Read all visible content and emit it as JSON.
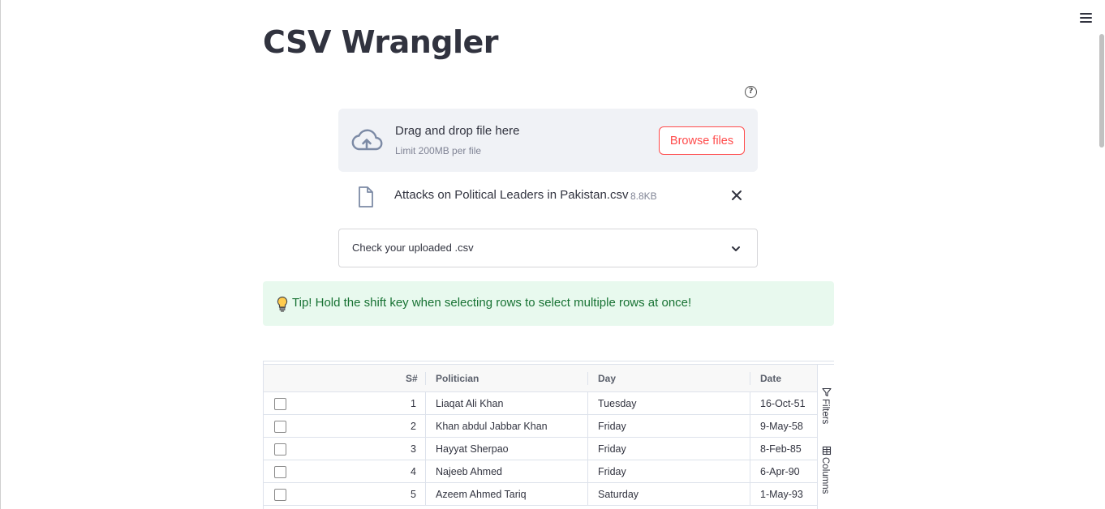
{
  "app": {
    "title": "CSV Wrangler",
    "menu_icon": "hamburger-menu-icon"
  },
  "uploader": {
    "help_icon": "question-circle-icon",
    "upload_icon": "cloud-upload-icon",
    "instruction": "Drag and drop file here",
    "limit": "Limit 200MB per file",
    "browse_label": "Browse files",
    "file": {
      "icon": "file-icon",
      "name": "Attacks on Political Leaders in Pakistan.csv",
      "size": "8.8KB",
      "remove_icon": "close-icon"
    }
  },
  "expander": {
    "label": "Check your uploaded .csv",
    "icon": "chevron-down-icon"
  },
  "tip": {
    "icon": "lightbulb-icon",
    "text": "Tip! Hold the shift key when selecting rows to select multiple rows at once!",
    "text_color": "#177233",
    "background": "#e8f9ee"
  },
  "grid": {
    "columns": [
      "S#",
      "Politician",
      "Day",
      "Date"
    ],
    "rows": [
      [
        "1",
        "Liaqat Ali Khan",
        "Tuesday",
        "16-Oct-51"
      ],
      [
        "2",
        "Khan abdul Jabbar Khan",
        "Friday",
        "9-May-58"
      ],
      [
        "3",
        "Hayyat Sherpao",
        "Friday",
        "8-Feb-85"
      ],
      [
        "4",
        "Najeeb Ahmed",
        "Friday",
        "6-Apr-90"
      ],
      [
        "5",
        "Azeem Ahmed Tariq",
        "Saturday",
        "1-May-93"
      ]
    ],
    "side_panel": {
      "filters_label": "Filters",
      "filters_icon": "filter-icon",
      "columns_label": "Columns",
      "columns_icon": "columns-icon"
    }
  },
  "colors": {
    "accent": "#ff4b4b",
    "text": "#31333f",
    "dropzone_bg": "#f0f2f6"
  }
}
